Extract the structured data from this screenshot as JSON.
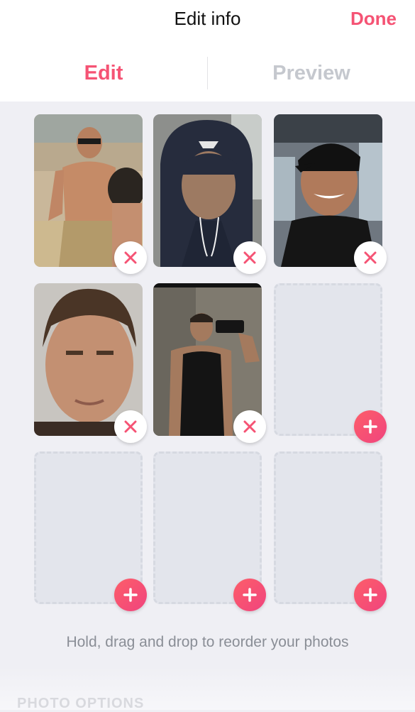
{
  "header": {
    "title": "Edit info",
    "done_label": "Done"
  },
  "tabs": [
    {
      "label": "Edit",
      "active": true
    },
    {
      "label": "Preview",
      "active": false
    }
  ],
  "photos": [
    {
      "description": "photo-1",
      "state": "filled",
      "action_icon": "close-icon"
    },
    {
      "description": "photo-2",
      "state": "filled",
      "action_icon": "close-icon"
    },
    {
      "description": "photo-3",
      "state": "filled",
      "action_icon": "close-icon"
    },
    {
      "description": "photo-4",
      "state": "filled",
      "action_icon": "close-icon"
    },
    {
      "description": "photo-5",
      "state": "filled",
      "action_icon": "close-icon"
    },
    {
      "description": "slot-6",
      "state": "empty",
      "action_icon": "plus-icon"
    },
    {
      "description": "slot-7",
      "state": "empty",
      "action_icon": "plus-icon"
    },
    {
      "description": "slot-8",
      "state": "empty",
      "action_icon": "plus-icon"
    },
    {
      "description": "slot-9",
      "state": "empty",
      "action_icon": "plus-icon"
    }
  ],
  "hint_text": "Hold, drag and drop to reorder your photos",
  "section_label": "PHOTO OPTIONS",
  "colors": {
    "accent": "#f55374",
    "inactive_tab": "#c5c8ce",
    "empty_slot": "#e3e5ec"
  }
}
